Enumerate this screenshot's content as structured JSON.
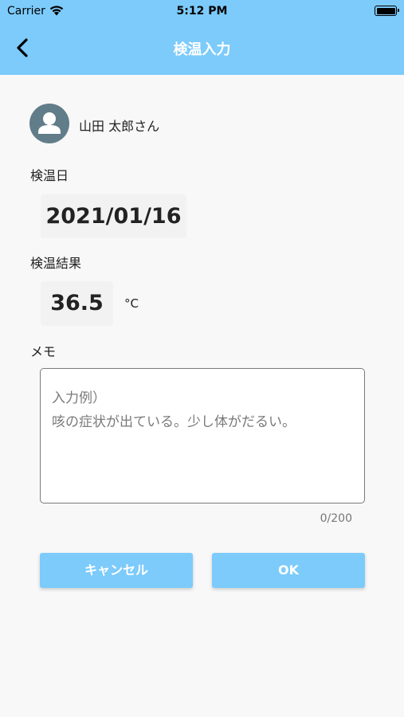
{
  "status_bar": {
    "carrier": "Carrier",
    "time": "5:12 PM",
    "icons": [
      "wifi-icon",
      "battery-icon"
    ]
  },
  "header": {
    "title": "検温入力",
    "back_icon": "chevron-left-icon",
    "color": "#7ccbfb"
  },
  "user": {
    "name": "山田 太郎さん",
    "avatar_icon": "person-icon",
    "avatar_color": "#617d8a"
  },
  "form": {
    "date_label": "検温日",
    "date_value": "2021/01/16",
    "result_label": "検温結果",
    "temperature_value": "36.5",
    "temperature_unit": "°C",
    "memo_label": "メモ",
    "memo_placeholder": "入力例）\n咳の症状が出ている。少し体がだるい。",
    "memo_counter": "0/200"
  },
  "buttons": {
    "cancel_label": "キャンセル",
    "ok_label": "OK"
  }
}
